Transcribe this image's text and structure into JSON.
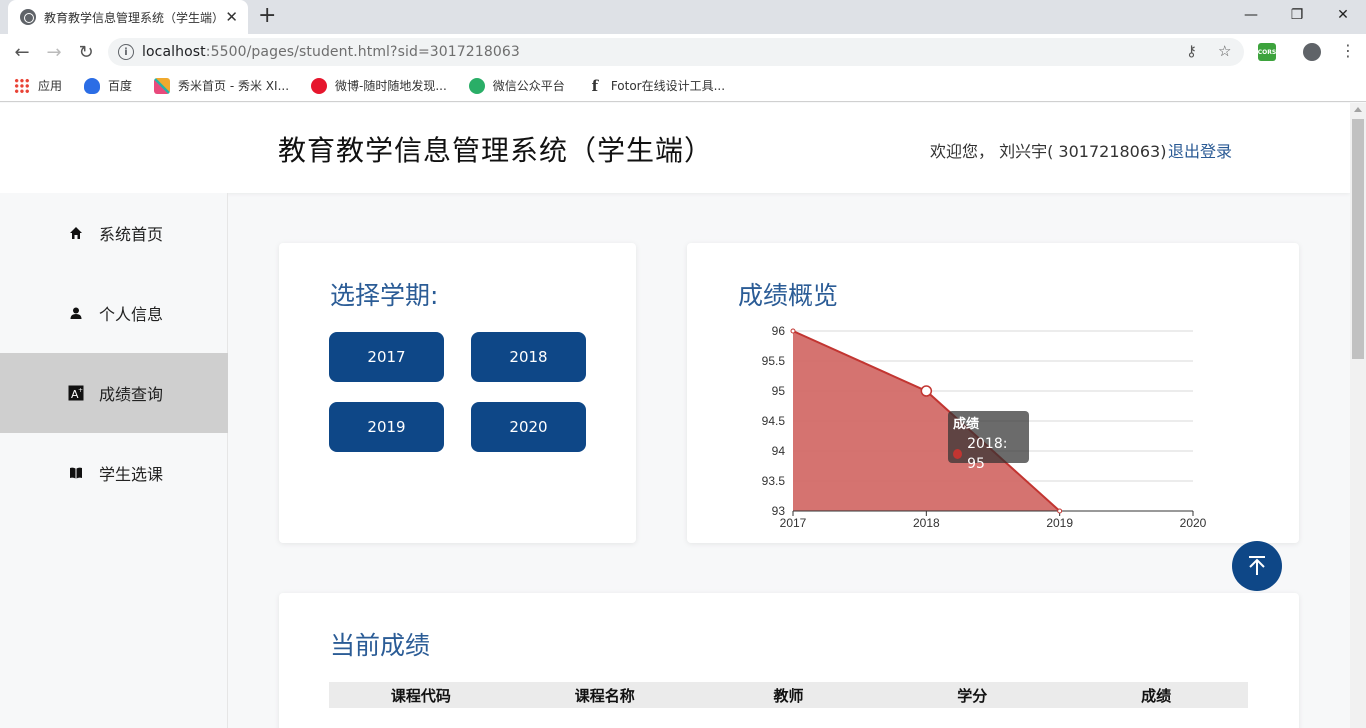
{
  "browser": {
    "tab_title": "教育教学信息管理系统（学生端）",
    "url_host": "localhost",
    "url_rest": ":5500/pages/student.html?sid=3017218063",
    "bookmarks": [
      {
        "label": "应用",
        "icon": "apps-grid-icon",
        "color": "#e94235"
      },
      {
        "label": "百度",
        "icon": "baidu-paw-icon",
        "color": "#2b6de5"
      },
      {
        "label": "秀米首页 - 秀米 XI...",
        "icon": "xiumi-icon",
        "color": "#e84a7c"
      },
      {
        "label": "微博-随时随地发现...",
        "icon": "weibo-icon",
        "color": "#e6162d"
      },
      {
        "label": "微信公众平台",
        "icon": "wechat-icon",
        "color": "#2aae67"
      },
      {
        "label": "Fotor在线设计工具...",
        "icon": "fotor-icon",
        "color": "#111111"
      }
    ],
    "extension_label": "CORS"
  },
  "header": {
    "title": "教育教学信息管理系统（学生端）",
    "welcome": "欢迎您， 刘兴宇( 3017218063)",
    "logout": "退出登录"
  },
  "sidebar": {
    "items": [
      {
        "label": "系统首页",
        "icon": "home-icon"
      },
      {
        "label": "个人信息",
        "icon": "user-icon"
      },
      {
        "label": "成绩查询",
        "icon": "grade-icon",
        "active": true
      },
      {
        "label": "学生选课",
        "icon": "book-icon"
      }
    ]
  },
  "semester": {
    "title": "选择学期:",
    "years": [
      "2017",
      "2018",
      "2019",
      "2020"
    ]
  },
  "overview": {
    "title": "成绩概览",
    "tooltip_series": "成绩",
    "tooltip_value": "2018: 95"
  },
  "chart_data": {
    "type": "area",
    "x": [
      2017,
      2018,
      2019
    ],
    "series": [
      {
        "name": "成绩",
        "values": [
          96,
          95,
          93
        ]
      }
    ],
    "xlim": [
      2017,
      2020
    ],
    "ylim": [
      93,
      96
    ],
    "x_ticks": [
      "2017",
      "2018",
      "2019",
      "2020"
    ],
    "y_ticks": [
      "93",
      "93.5",
      "94",
      "94.5",
      "95",
      "95.5",
      "96"
    ],
    "grid": true,
    "fill_color": "#d36b68",
    "line_color": "#c23531"
  },
  "current": {
    "title": "当前成绩",
    "columns": [
      "课程代码",
      "课程名称",
      "教师",
      "学分",
      "成绩"
    ]
  },
  "colors": {
    "primary": "#0e4787",
    "title_blue": "#2b5c96",
    "active_sidebar": "#cfcfcf"
  }
}
